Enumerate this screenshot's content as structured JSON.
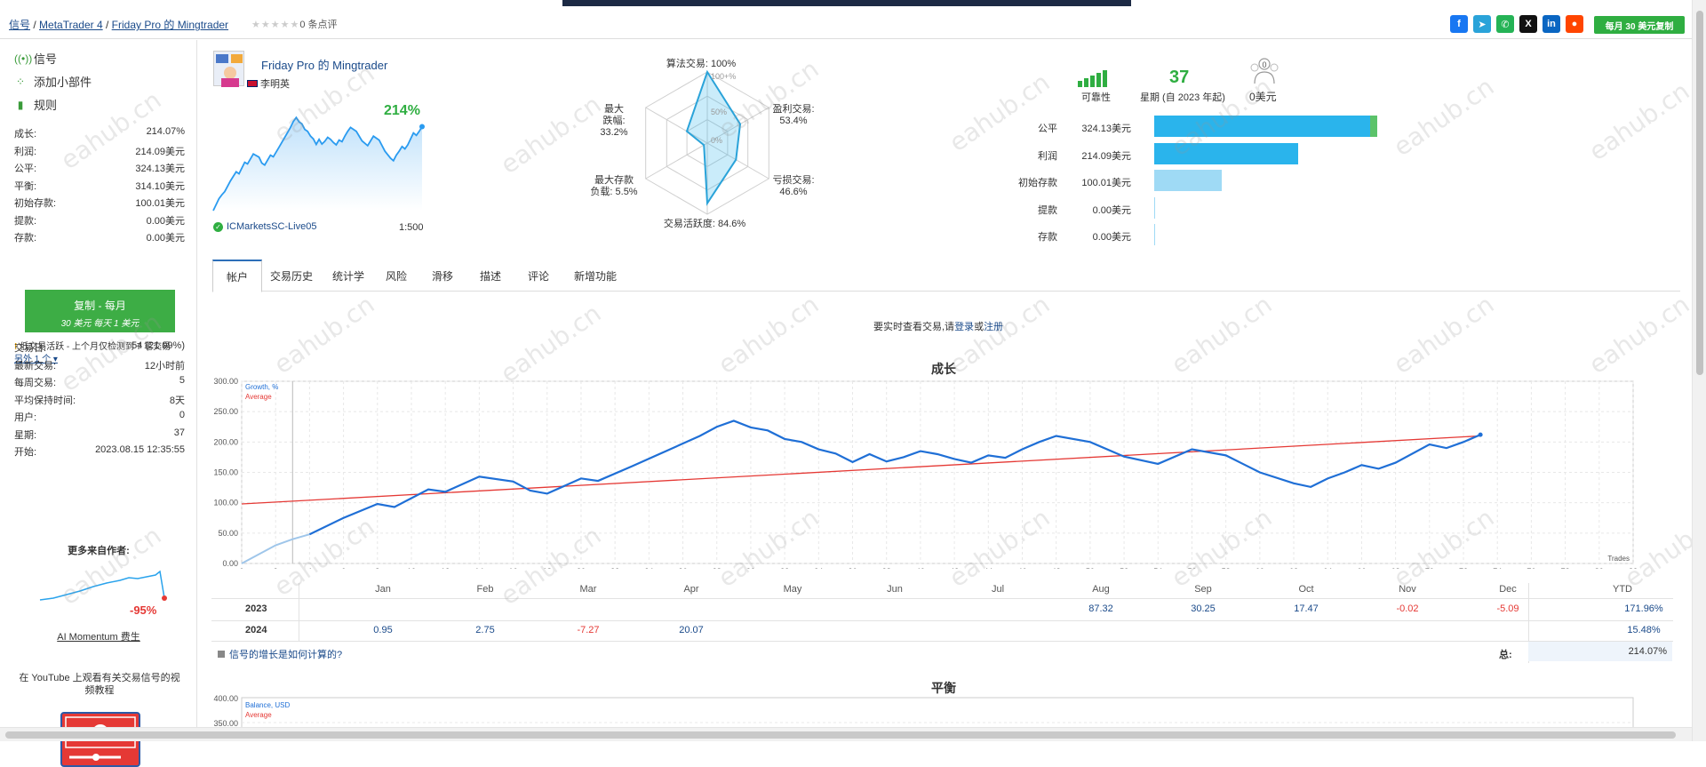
{
  "breadcrumb": {
    "root": "信号",
    "platform": "MetaTrader 4",
    "signal": "Friday Pro 的 Mingtrader",
    "sep": "/"
  },
  "rating": {
    "stars": "★★★★★",
    "count_text": "0 条点评"
  },
  "share_icons": [
    "facebook-icon",
    "telegram-icon",
    "whatsapp-icon",
    "x-icon",
    "linkedin-icon",
    "reddit-icon"
  ],
  "copy_top_button": "每月 30 美元复制",
  "sidebar": {
    "nav": [
      "信号",
      "添加小部件",
      "规则"
    ],
    "stats": [
      {
        "k": "成长:",
        "v": "214.07%"
      },
      {
        "k": "利润:",
        "v": "214.09美元"
      },
      {
        "k": "公平:",
        "v": "324.13美元"
      },
      {
        "k": "平衡:",
        "v": "314.10美元"
      },
      {
        "k": "初始存款:",
        "v": "100.01美元"
      },
      {
        "k": "提款:",
        "v": "0.00美元"
      },
      {
        "k": "存款:",
        "v": "0.00美元"
      }
    ],
    "copy_box": {
      "line1": "复制 - 每月",
      "line2": "30 美元 每天 1 美元"
    },
    "low_activity": "低交易活跃 - 上个月仅检测到 7 笔交易",
    "more_link": "另外 1 个",
    "stats2": [
      {
        "k": "交易日:",
        "v": "54 (21.09%)"
      },
      {
        "k": "最新交易:",
        "v": "12小时前"
      },
      {
        "k": "每周交易:",
        "v": "5"
      },
      {
        "k": "平均保持时间:",
        "v": "8天"
      },
      {
        "k": "用户:",
        "v": "0"
      },
      {
        "k": "星期:",
        "v": "37"
      },
      {
        "k": "开始:",
        "v": "2023.08.15 12:35:55"
      }
    ],
    "more_from_author": "更多来自作者:",
    "author_signal_pct": "-95%",
    "author_signal_name": "AI Momentum 费生",
    "youtube_text": "在 YouTube 上观看有关交易信号的视频教程"
  },
  "signal": {
    "title": "Friday Pro 的 Mingtrader",
    "author": "李明英",
    "growth": "214%",
    "broker": "ICMarketsSC-Live05",
    "leverage": "1:500"
  },
  "radar": {
    "labels": {
      "algo": "算法交易: 100%",
      "profit_trades": "盈利交易:",
      "profit_trades_val": "53.4%",
      "loss_trades": "亏损交易:",
      "loss_trades_val": "46.6%",
      "activity": "交易活跃度: 84.6%",
      "max_load": "最大存款",
      "max_load2": "负载: 5.5%",
      "drawdown": "最大",
      "drawdown2": "跌幅:",
      "drawdown_val": "33.2%"
    },
    "scale": [
      "100+%",
      "50%",
      "0%"
    ],
    "values": [
      100,
      53.4,
      46.6,
      84.6,
      5.5,
      33.2
    ]
  },
  "summary": {
    "reliability": "可靠性",
    "weeks": "37",
    "weeks_label": "星期 (自 2023 年起)",
    "subscribers": "0",
    "subscribers_label": "0美元",
    "bars": [
      {
        "label": "公平",
        "value": "324.13美元",
        "amount": 324.13,
        "color": "#2ab4ec"
      },
      {
        "label": "利润",
        "value": "214.09美元",
        "amount": 214.09,
        "color": "#2ab4ec"
      },
      {
        "label": "初始存款",
        "value": "100.01美元",
        "amount": 100.01,
        "color": "#9fdaf5"
      },
      {
        "label": "提款",
        "value": "0.00美元",
        "amount": 0,
        "color": "#2ab4ec"
      },
      {
        "label": "存款",
        "value": "0.00美元",
        "amount": 0,
        "color": "#2ab4ec"
      }
    ]
  },
  "tabs": [
    "帐户",
    "交易历史",
    "统计学",
    "风险",
    "滑移",
    "描述",
    "评论",
    "新增功能"
  ],
  "login_line": {
    "prefix": "要实时查看交易,请",
    "login": "登录",
    "or": "或",
    "register": "注册"
  },
  "growth_section_title": "成长",
  "balance_section_title": "平衡",
  "chart_data": [
    {
      "type": "line",
      "title": "成长",
      "legend": [
        "Growth, %",
        "Average"
      ],
      "xlabel": "Trades",
      "ylim": [
        0,
        300
      ],
      "yticks": [
        "0.00",
        "50.00",
        "100.00",
        "150.00",
        "200.00",
        "250.00",
        "300.00"
      ],
      "xticks": [
        0,
        2,
        4,
        6,
        8,
        10,
        12,
        14,
        16,
        18,
        20,
        22,
        24,
        26,
        28,
        30,
        32,
        34,
        36,
        38,
        40,
        42,
        44,
        46,
        48,
        50,
        52,
        54,
        56,
        58,
        60,
        62,
        64,
        66,
        68,
        70,
        72,
        74,
        76,
        78,
        80,
        82
      ],
      "xlim": [
        0,
        82
      ],
      "series": [
        {
          "name": "Growth, %",
          "x": [
            0,
            2,
            3,
            4,
            6,
            8,
            9,
            11,
            12,
            14,
            16,
            17,
            18,
            20,
            21,
            23,
            25,
            27,
            28,
            29,
            30,
            31,
            32,
            33,
            34,
            35,
            36,
            37,
            38,
            39,
            40,
            41,
            42,
            43,
            44,
            45,
            46,
            47,
            48,
            50,
            52,
            54,
            56,
            58,
            60,
            62,
            63,
            64,
            65,
            66,
            67,
            68,
            70,
            71,
            72,
            73
          ],
          "y": [
            0,
            30,
            40,
            48,
            75,
            98,
            93,
            122,
            118,
            143,
            135,
            120,
            115,
            140,
            136,
            160,
            185,
            210,
            225,
            235,
            224,
            219,
            205,
            200,
            188,
            181,
            167,
            180,
            168,
            175,
            185,
            180,
            172,
            166,
            178,
            174,
            188,
            200,
            210,
            200,
            176,
            164,
            188,
            178,
            150,
            132,
            126,
            140,
            150,
            162,
            156,
            166,
            196,
            190,
            200,
            212
          ]
        },
        {
          "name": "Average",
          "x": [
            0,
            73
          ],
          "y": [
            98,
            210
          ]
        }
      ],
      "monthly": {
        "months": [
          "Jan",
          "Feb",
          "Mar",
          "Apr",
          "May",
          "Jun",
          "Jul",
          "Aug",
          "Sep",
          "Oct",
          "Nov",
          "Dec",
          "YTD"
        ],
        "rows": [
          {
            "year": "2023",
            "values": [
              "",
              "",
              "",
              "",
              "",
              "",
              "",
              "87.32",
              "30.25",
              "17.47",
              "-0.02",
              "-5.09",
              "171.96%"
            ]
          },
          {
            "year": "2024",
            "values": [
              "0.95",
              "2.75",
              "-7.27",
              "20.07",
              "",
              "",
              "",
              "",
              "",
              "",
              "",
              "",
              "15.48%"
            ]
          }
        ]
      },
      "calc_link": "信号的增长是如何计算的?",
      "total_label": "总:",
      "total_value": "214.07%"
    },
    {
      "type": "line",
      "title": "平衡",
      "legend": [
        "Balance, USD",
        "Average"
      ],
      "yticks": [
        "400.00",
        "350.00"
      ],
      "series": []
    }
  ],
  "watermark": "eahub.cn",
  "colors": {
    "green": "#2fae41",
    "blue": "#1a4a8a",
    "line": "#1f6fd6",
    "avg": "#e53935"
  }
}
